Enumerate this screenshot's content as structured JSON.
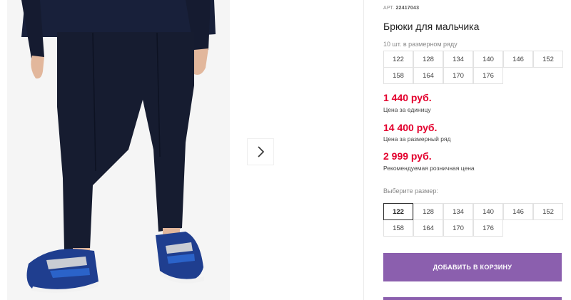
{
  "product": {
    "article_prefix": "АРТ.",
    "article_number": "22417043",
    "title": "Брюки для мальчика",
    "pack_info": "10 шт. в размерном ряду"
  },
  "size_range": [
    "122",
    "128",
    "134",
    "140",
    "146",
    "152",
    "158",
    "164",
    "170",
    "176"
  ],
  "prices": [
    {
      "value": "1 440 руб.",
      "label": "Цена за единицу"
    },
    {
      "value": "14 400 руб.",
      "label": "Цена за размерный ряд"
    },
    {
      "value": "2 999 руб.",
      "label": "Рекомендуемая розничная цена"
    }
  ],
  "size_picker": {
    "label": "Выберите размер:",
    "selected": "122",
    "options": [
      "122",
      "128",
      "134",
      "140",
      "146",
      "152",
      "158",
      "164",
      "170",
      "176"
    ]
  },
  "actions": {
    "add_to_cart": "ДОБАВИТЬ В КОРЗИНУ"
  },
  "colors": {
    "price": "#e3002d",
    "accent": "#8b5fae",
    "pants": "#161c30"
  },
  "icons": {
    "next": "chevron-right-icon"
  }
}
